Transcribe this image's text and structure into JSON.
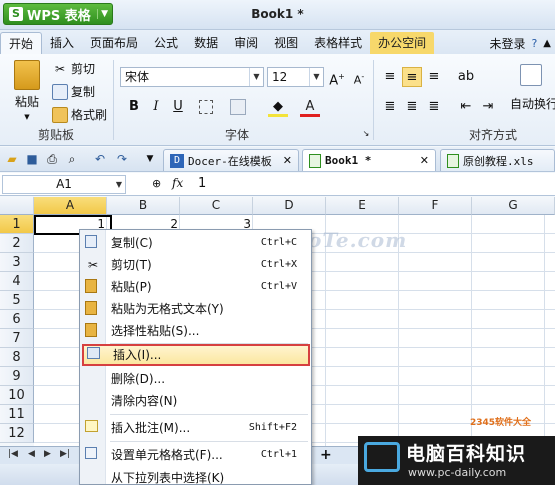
{
  "app": {
    "name": "WPS 表格",
    "document_title": "Book1 *"
  },
  "menu_tabs": [
    "开始",
    "插入",
    "页面布局",
    "公式",
    "数据",
    "审阅",
    "视图",
    "表格样式",
    "办公空间"
  ],
  "account": {
    "login": "未登录"
  },
  "ribbon": {
    "clipboard": {
      "paste": "粘贴",
      "cut": "剪切",
      "copy": "复制",
      "format_painter": "格式刷",
      "group": "剪贴板"
    },
    "font": {
      "name": "宋体",
      "size": "12",
      "bold": "B",
      "italic": "I",
      "underline": "U",
      "group": "字体"
    },
    "alignment": {
      "group": "对齐方式",
      "wrap": "自动换行"
    }
  },
  "doc_tabs": [
    {
      "label": "Docer-在线模板"
    },
    {
      "label": "Book1 *"
    },
    {
      "label": "原创教程.xls"
    }
  ],
  "formula_bar": {
    "cell_ref": "A1",
    "value": "1"
  },
  "columns": [
    "A",
    "B",
    "C",
    "D",
    "E",
    "F",
    "G"
  ],
  "rows": [
    "1",
    "2",
    "3",
    "4",
    "5",
    "6",
    "7",
    "8",
    "9",
    "10",
    "11",
    "12"
  ],
  "cell_values": {
    "A1": "1",
    "B1": "2",
    "C1": "3"
  },
  "context_menu": {
    "copy": {
      "label": "复制(C)",
      "shortcut": "Ctrl+C"
    },
    "cut": {
      "label": "剪切(T)",
      "shortcut": "Ctrl+X"
    },
    "paste": {
      "label": "粘贴(P)",
      "shortcut": "Ctrl+V"
    },
    "paste_plain": {
      "label": "粘贴为无格式文本(Y)"
    },
    "paste_special": {
      "label": "选择性粘贴(S)..."
    },
    "insert": {
      "label": "插入(I)..."
    },
    "delete": {
      "label": "删除(D)..."
    },
    "clear": {
      "label": "清除内容(N)"
    },
    "insert_comment": {
      "label": "插入批注(M)...",
      "shortcut": "Shift+F2"
    },
    "format_cells": {
      "label": "设置单元格格式(F)...",
      "shortcut": "Ctrl+1"
    },
    "pick_list": {
      "label": "从下拉列表中选择(K)"
    }
  },
  "watermark": {
    "text": "Docs@DuoTe.com"
  },
  "branding": {
    "site": "电脑百科知识",
    "url": "www.pc-daily.com",
    "small_logo": "2345软件大全"
  }
}
